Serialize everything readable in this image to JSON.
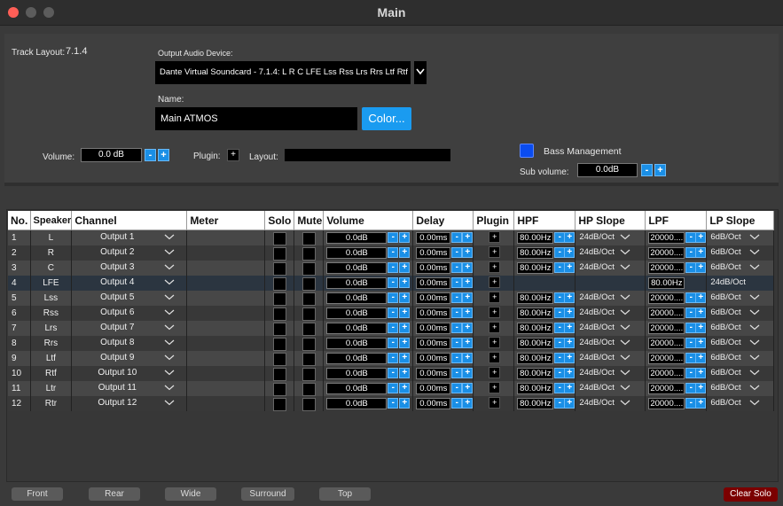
{
  "window": {
    "title": "Main"
  },
  "track": {
    "layout_label": "Track Layout:",
    "layout_value": "7.1.4"
  },
  "output_device": {
    "label": "Output Audio Device:",
    "value": "Dante Virtual Soundcard - 7.1.4: L R C LFE Lss Rss Lrs Rrs Ltf Rtf Ltr Rtr",
    "arrow_icon": "chevron-down-icon"
  },
  "name": {
    "label": "Name:",
    "value": "Main ATMOS",
    "color_button": "Color...",
    "color_button_color": "#1a9bf0"
  },
  "volume": {
    "label": "Volume:",
    "value": "0.0 dB",
    "minus": "-",
    "plus": "+"
  },
  "plugin": {
    "label": "Plugin:",
    "button": "+"
  },
  "layout": {
    "label": "Layout:",
    "value": ""
  },
  "bass": {
    "label": "Bass Management",
    "checked": true,
    "accent": "#0a4cf0"
  },
  "sub_volume": {
    "label": "Sub volume:",
    "value": "0.0dB",
    "minus": "-",
    "plus": "+"
  },
  "table": {
    "headers": [
      "No.",
      "Speaker",
      "Channel",
      "Meter",
      "Solo",
      "Mute",
      "Volume",
      "Delay",
      "Plugin",
      "HPF",
      "HP Slope",
      "LPF",
      "LP Slope"
    ],
    "minus": "-",
    "plus": "+",
    "plugin_button": "+",
    "rows": [
      {
        "no": "1",
        "speaker": "L",
        "channel": "Output 1",
        "volume": "0.0dB",
        "delay": "0.00ms",
        "hpf": "80.00Hz",
        "hp_slope": "24dB/Oct",
        "lpf": "20000....",
        "lp_slope": "6dB/Oct"
      },
      {
        "no": "2",
        "speaker": "R",
        "channel": "Output 2",
        "volume": "0.0dB",
        "delay": "0.00ms",
        "hpf": "80.00Hz",
        "hp_slope": "24dB/Oct",
        "lpf": "20000....",
        "lp_slope": "6dB/Oct"
      },
      {
        "no": "3",
        "speaker": "C",
        "channel": "Output 3",
        "volume": "0.0dB",
        "delay": "0.00ms",
        "hpf": "80.00Hz",
        "hp_slope": "24dB/Oct",
        "lpf": "20000....",
        "lp_slope": "6dB/Oct"
      },
      {
        "no": "4",
        "speaker": "LFE",
        "channel": "Output 4",
        "volume": "0.0dB",
        "delay": "0.00ms",
        "hpf": "",
        "hp_slope": "",
        "lpf": "80.00Hz",
        "lp_slope": "24dB/Oct"
      },
      {
        "no": "5",
        "speaker": "Lss",
        "channel": "Output 5",
        "volume": "0.0dB",
        "delay": "0.00ms",
        "hpf": "80.00Hz",
        "hp_slope": "24dB/Oct",
        "lpf": "20000....",
        "lp_slope": "6dB/Oct"
      },
      {
        "no": "6",
        "speaker": "Rss",
        "channel": "Output 6",
        "volume": "0.0dB",
        "delay": "0.00ms",
        "hpf": "80.00Hz",
        "hp_slope": "24dB/Oct",
        "lpf": "20000....",
        "lp_slope": "6dB/Oct"
      },
      {
        "no": "7",
        "speaker": "Lrs",
        "channel": "Output 7",
        "volume": "0.0dB",
        "delay": "0.00ms",
        "hpf": "80.00Hz",
        "hp_slope": "24dB/Oct",
        "lpf": "20000....",
        "lp_slope": "6dB/Oct"
      },
      {
        "no": "8",
        "speaker": "Rrs",
        "channel": "Output 8",
        "volume": "0.0dB",
        "delay": "0.00ms",
        "hpf": "80.00Hz",
        "hp_slope": "24dB/Oct",
        "lpf": "20000....",
        "lp_slope": "6dB/Oct"
      },
      {
        "no": "9",
        "speaker": "Ltf",
        "channel": "Output 9",
        "volume": "0.0dB",
        "delay": "0.00ms",
        "hpf": "80.00Hz",
        "hp_slope": "24dB/Oct",
        "lpf": "20000....",
        "lp_slope": "6dB/Oct"
      },
      {
        "no": "10",
        "speaker": "Rtf",
        "channel": "Output 10",
        "volume": "0.0dB",
        "delay": "0.00ms",
        "hpf": "80.00Hz",
        "hp_slope": "24dB/Oct",
        "lpf": "20000....",
        "lp_slope": "6dB/Oct"
      },
      {
        "no": "11",
        "speaker": "Ltr",
        "channel": "Output 11",
        "volume": "0.0dB",
        "delay": "0.00ms",
        "hpf": "80.00Hz",
        "hp_slope": "24dB/Oct",
        "lpf": "20000....",
        "lp_slope": "6dB/Oct"
      },
      {
        "no": "12",
        "speaker": "Rtr",
        "channel": "Output 12",
        "volume": "0.0dB",
        "delay": "0.00ms",
        "hpf": "80.00Hz",
        "hp_slope": "24dB/Oct",
        "lpf": "20000....",
        "lp_slope": "6dB/Oct"
      }
    ]
  },
  "presets": [
    "Front",
    "Rear",
    "Wide",
    "Surround",
    "Top"
  ],
  "clear_solo": {
    "label": "Clear Solo",
    "color": "#7b0000"
  }
}
